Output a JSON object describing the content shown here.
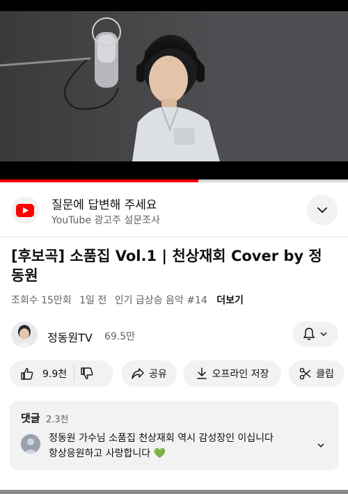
{
  "video": {
    "progress_fraction": 0.57
  },
  "colors": {
    "accent": "#ff0000",
    "chip_bg": "#f2f2f2",
    "secondary_text": "#606060",
    "heart": "#4caf50"
  },
  "survey": {
    "icon": "youtube-logo-icon",
    "title": "질문에 답변해 주세요",
    "subtitle": "YouTube 광고주 설문조사",
    "expand_icon": "chevron-down-icon"
  },
  "video_info": {
    "title": "[후보곡] 소품집 Vol.1 | 천상재회 Cover by 정동원",
    "views": "조회수 15만회",
    "age": "1일 전",
    "trending": "인기 급상승 음악 #14",
    "more": "더보기"
  },
  "channel": {
    "name": "정동원TV",
    "subscribers": "69.5만",
    "bell_icon": "bell-icon"
  },
  "actions": {
    "likes": "9.9천",
    "share": "공유",
    "offline": "오프라인 저장",
    "clip": "클립"
  },
  "comments": {
    "label": "댓글",
    "count": "2.3천",
    "top_comment_line1": "정동원 가수님 소품집 천상재회 역시 감성장인 이십니다",
    "top_comment_line2": "항상응원하고 사랑합니다",
    "emoji": "💚"
  }
}
